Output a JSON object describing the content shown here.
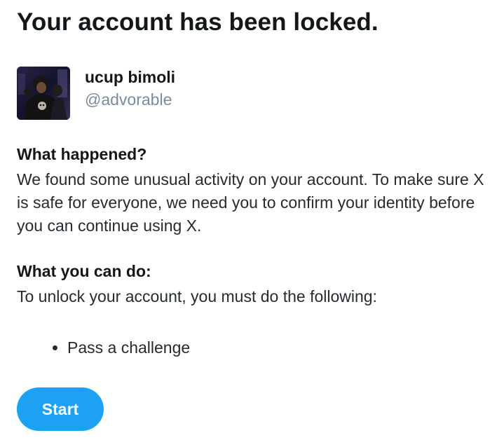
{
  "page": {
    "title": "Your account has been locked."
  },
  "profile": {
    "display_name": "ucup bimoli",
    "handle": "@advorable",
    "avatar_icon": "user-photo"
  },
  "sections": {
    "what_happened": {
      "heading": "What happened?",
      "text": "We found some unusual activity on your account. To make sure X is safe for everyone, we need you to confirm your identity before you can continue using X."
    },
    "what_you_can_do": {
      "heading": "What you can do:",
      "text": "To unlock your account, you must do the following:",
      "steps": [
        "Pass a challenge"
      ]
    }
  },
  "actions": {
    "start_label": "Start"
  },
  "colors": {
    "accent": "#1da1f2",
    "text_primary": "#14171a",
    "text_secondary": "#7d8b98"
  }
}
